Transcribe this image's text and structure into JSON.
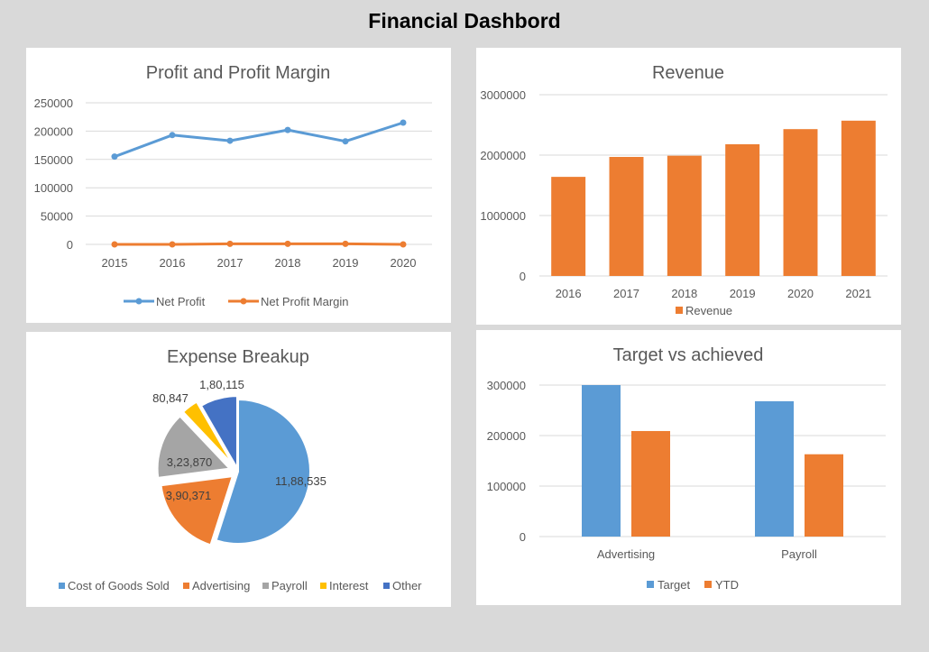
{
  "dashboard": {
    "title": "Financial Dashbord"
  },
  "colors": {
    "blue": "#5b9bd5",
    "orange": "#ed7d31",
    "gray": "#a5a5a5",
    "yellow": "#ffc000",
    "darkblue": "#4472c4",
    "grid": "#d9d9d9",
    "text": "#595959"
  },
  "chart_data": [
    {
      "type": "line",
      "title": "Profit and Profit Margin",
      "x": [
        "2015",
        "2016",
        "2017",
        "2018",
        "2019",
        "2020"
      ],
      "series": [
        {
          "name": "Net Profit",
          "values": [
            155000,
            193000,
            183000,
            202000,
            182000,
            215000
          ]
        },
        {
          "name": "Net Profit Margin",
          "values": [
            0,
            0,
            1000,
            1000,
            1000,
            0
          ]
        }
      ],
      "ylim": [
        0,
        250000
      ],
      "yticks": [
        "0",
        "50000",
        "100000",
        "150000",
        "200000",
        "250000"
      ],
      "grid": true,
      "legend": "bottom"
    },
    {
      "type": "bar",
      "title": "Revenue",
      "categories": [
        "2016",
        "2017",
        "2018",
        "2019",
        "2020",
        "2021"
      ],
      "series": [
        {
          "name": "Revenue",
          "values": [
            1640000,
            1970000,
            1990000,
            2180000,
            2430000,
            2570000
          ]
        }
      ],
      "ylim": [
        0,
        3000000
      ],
      "yticks": [
        "0",
        "1000000",
        "2000000",
        "3000000"
      ],
      "grid": true,
      "legend": "bottom"
    },
    {
      "type": "pie",
      "title": "Expense Breakup",
      "labels": [
        "Cost of Goods Sold",
        "Advertising",
        "Payroll",
        "Interest",
        "Other"
      ],
      "values": [
        1188535,
        390371,
        323870,
        80847,
        180115
      ],
      "value_labels": [
        "11,88,535",
        "3,90,371",
        "3,23,870",
        "80,847",
        "1,80,115"
      ],
      "legend": "bottom"
    },
    {
      "type": "bar",
      "title": "Target vs achieved",
      "categories": [
        "Advertising",
        "Payroll"
      ],
      "series": [
        {
          "name": "Target",
          "values": [
            300000,
            268000
          ]
        },
        {
          "name": "YTD",
          "values": [
            209000,
            163000
          ]
        }
      ],
      "ylim": [
        0,
        300000
      ],
      "yticks": [
        "0",
        "100000",
        "200000",
        "300000"
      ],
      "grid": true,
      "legend": "bottom"
    }
  ]
}
